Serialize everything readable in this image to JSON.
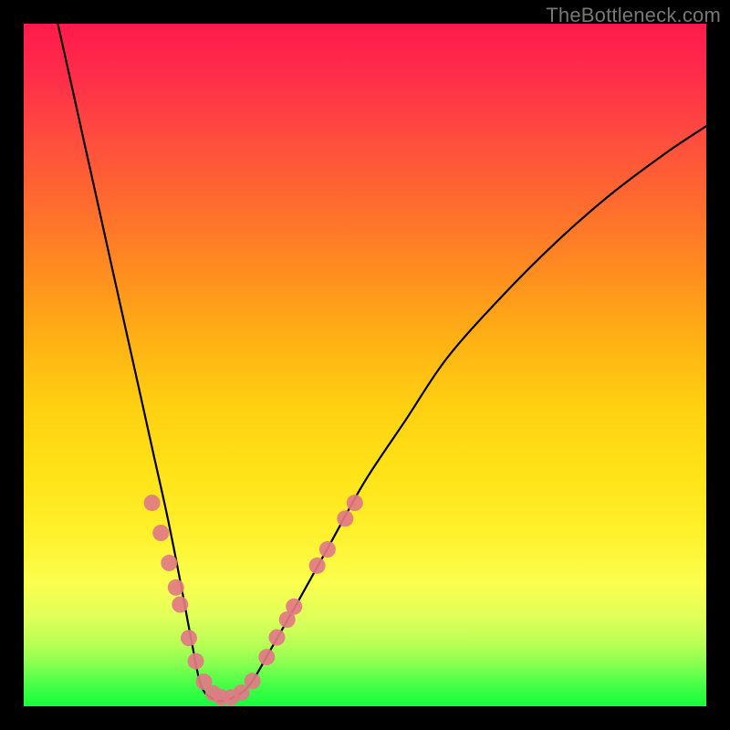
{
  "watermark": "TheBottleneck.com",
  "chart_data": {
    "type": "line",
    "title": "",
    "xlabel": "",
    "ylabel": "",
    "xlim": [
      0,
      100
    ],
    "ylim": [
      0,
      100
    ],
    "grid": false,
    "legend": false,
    "series": [
      {
        "name": "bottleneck-curve",
        "x": [
          5,
          7,
          9,
          11,
          13,
          15,
          17,
          19,
          21,
          23,
          24.5,
          26,
          28,
          30,
          33,
          36,
          40,
          45,
          50,
          56,
          62,
          70,
          78,
          86,
          94,
          100
        ],
        "y": [
          100,
          91,
          82,
          73,
          64,
          55,
          46,
          37,
          28,
          18,
          10,
          3,
          1,
          1,
          3,
          8,
          15,
          24,
          33,
          42,
          51,
          60,
          68,
          75,
          81,
          85
        ]
      }
    ],
    "dots": {
      "name": "highlight-dots",
      "points": [
        {
          "x": 18.8,
          "y": 29.8
        },
        {
          "x": 20.1,
          "y": 25.4
        },
        {
          "x": 21.3,
          "y": 21.0
        },
        {
          "x": 22.3,
          "y": 17.4
        },
        {
          "x": 22.9,
          "y": 14.9
        },
        {
          "x": 24.2,
          "y": 10.0
        },
        {
          "x": 25.2,
          "y": 6.6
        },
        {
          "x": 26.4,
          "y": 3.6
        },
        {
          "x": 27.8,
          "y": 1.9
        },
        {
          "x": 29.0,
          "y": 1.3
        },
        {
          "x": 30.4,
          "y": 1.3
        },
        {
          "x": 31.9,
          "y": 2.0
        },
        {
          "x": 33.5,
          "y": 3.7
        },
        {
          "x": 35.6,
          "y": 7.2
        },
        {
          "x": 37.1,
          "y": 10.1
        },
        {
          "x": 38.6,
          "y": 12.7
        },
        {
          "x": 39.6,
          "y": 14.6
        },
        {
          "x": 43.0,
          "y": 20.6
        },
        {
          "x": 44.5,
          "y": 23.0
        },
        {
          "x": 47.1,
          "y": 27.5
        },
        {
          "x": 48.5,
          "y": 29.8
        }
      ],
      "radius": 9
    },
    "gradient_note": "Background encodes desirability: red (bad) at top to green (good) at bottom."
  }
}
